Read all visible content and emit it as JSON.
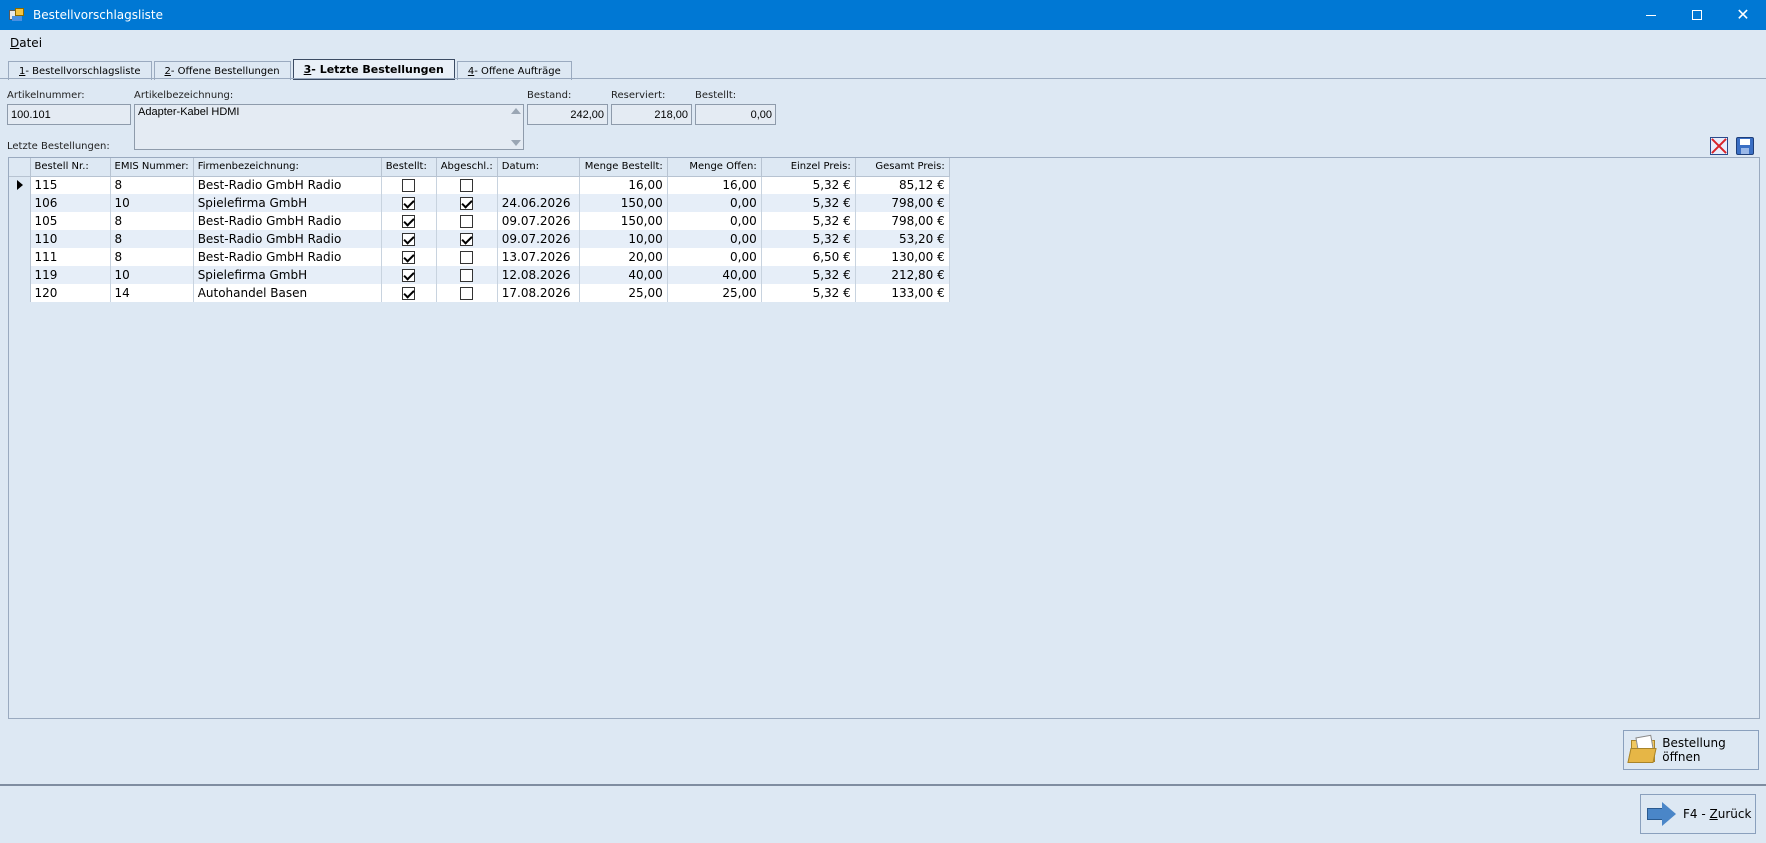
{
  "window": {
    "title": "Bestellvorschlagsliste"
  },
  "menu": {
    "datei_first": "D",
    "datei_rest": "atei"
  },
  "tabs": [
    {
      "key": "1",
      "label": " - Bestellvorschlagsliste"
    },
    {
      "key": "2",
      "label": " - Offene Bestellungen"
    },
    {
      "key": "3",
      "label": " - Letzte Bestellungen"
    },
    {
      "key": "4",
      "label": " - Offene Aufträge"
    }
  ],
  "article": {
    "nummer_label": "Artikelnummer:",
    "nummer": "100.101",
    "bezeichnung_label": "Artikelbezeichnung:",
    "bezeichnung": "Adapter-Kabel HDMI",
    "bestand_label": "Bestand:",
    "bestand": "242,00",
    "reserviert_label": "Reserviert:",
    "reserviert": "218,00",
    "bestellt_label": "Bestellt:",
    "bestellt": "0,00"
  },
  "grid": {
    "section_label": "Letzte Bestellungen:",
    "columns": [
      "Bestell Nr.:",
      "EMIS Nummer:",
      "Firmenbezeichnung:",
      "Bestellt:",
      "Abgeschl.:",
      "Datum:",
      "Menge Bestellt:",
      "Menge Offen:",
      "Einzel Preis:",
      "Gesamt Preis:"
    ],
    "rows": [
      {
        "nr": "115",
        "emis": "8",
        "firma": "Best-Radio GmbH Radio",
        "bestellt": false,
        "abgeschl": false,
        "datum": "",
        "menge_bestellt": "16,00",
        "menge_offen": "16,00",
        "einzel": "5,32 €",
        "gesamt": "85,12 €"
      },
      {
        "nr": "106",
        "emis": "10",
        "firma": "Spielefirma GmbH",
        "bestellt": true,
        "abgeschl": true,
        "datum": "24.06.2026",
        "menge_bestellt": "150,00",
        "menge_offen": "0,00",
        "einzel": "5,32 €",
        "gesamt": "798,00 €"
      },
      {
        "nr": "105",
        "emis": "8",
        "firma": "Best-Radio GmbH Radio",
        "bestellt": true,
        "abgeschl": false,
        "datum": "09.07.2026",
        "menge_bestellt": "150,00",
        "menge_offen": "0,00",
        "einzel": "5,32 €",
        "gesamt": "798,00 €"
      },
      {
        "nr": "110",
        "emis": "8",
        "firma": "Best-Radio GmbH Radio",
        "bestellt": true,
        "abgeschl": true,
        "datum": "09.07.2026",
        "menge_bestellt": "10,00",
        "menge_offen": "0,00",
        "einzel": "5,32 €",
        "gesamt": "53,20 €"
      },
      {
        "nr": "111",
        "emis": "8",
        "firma": "Best-Radio GmbH Radio",
        "bestellt": true,
        "abgeschl": false,
        "datum": "13.07.2026",
        "menge_bestellt": "20,00",
        "menge_offen": "0,00",
        "einzel": "6,50 €",
        "gesamt": "130,00 €"
      },
      {
        "nr": "119",
        "emis": "10",
        "firma": "Spielefirma GmbH",
        "bestellt": true,
        "abgeschl": false,
        "datum": "12.08.2026",
        "menge_bestellt": "40,00",
        "menge_offen": "40,00",
        "einzel": "5,32 €",
        "gesamt": "212,80 €"
      },
      {
        "nr": "120",
        "emis": "14",
        "firma": "Autohandel Basen",
        "bestellt": true,
        "abgeschl": false,
        "datum": "17.08.2026",
        "menge_bestellt": "25,00",
        "menge_offen": "25,00",
        "einzel": "5,32 €",
        "gesamt": "133,00 €"
      }
    ]
  },
  "buttons": {
    "open_order": "Bestellung öffnen",
    "back_key": "F4 - ",
    "back_label_first": "Z",
    "back_label_rest": "urück"
  },
  "icons": {
    "app": "app-icon",
    "delete": "delete-icon",
    "save": "save-icon",
    "folder": "folder-icon",
    "back": "arrow-back-icon"
  }
}
